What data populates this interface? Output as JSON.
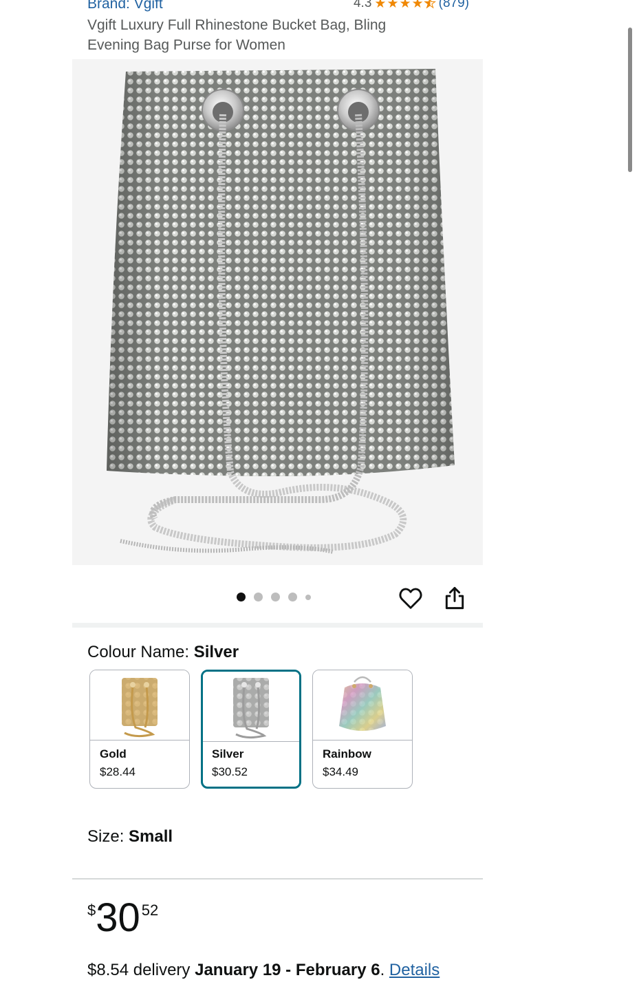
{
  "header": {
    "brand": "Brand: Vgift",
    "rating_value": "4.3",
    "rating_stars": 4.3,
    "review_count": "(879)",
    "title_line1": "Vgift Luxury Full Rhinestone Bucket Bag, Bling",
    "title_line2": "Evening Bag Purse for Women"
  },
  "gallery": {
    "image_count": 5,
    "active_index": 1,
    "wishlist_icon": "heart-outline-icon",
    "share_icon": "share-icon"
  },
  "colour": {
    "label": "Colour Name: ",
    "selected": "Silver",
    "options": [
      {
        "name": "Gold",
        "price": "$28.44",
        "color": "#d9b36c"
      },
      {
        "name": "Silver",
        "price": "$30.52",
        "color": "#b8b8b8"
      },
      {
        "name": "Rainbow",
        "price": "$34.49",
        "color": "#c9a2c4"
      }
    ]
  },
  "size": {
    "label": "Size: ",
    "selected": "Small"
  },
  "price": {
    "symbol": "$",
    "whole": "30",
    "fraction": "52"
  },
  "delivery": {
    "prefix": "$8.54 delivery ",
    "dates": "January 19 - February 6",
    "separator": ". ",
    "details_link": "Details"
  },
  "colors": {
    "link": "#2162a1",
    "selected_border": "#007185",
    "star": "#f08804"
  }
}
